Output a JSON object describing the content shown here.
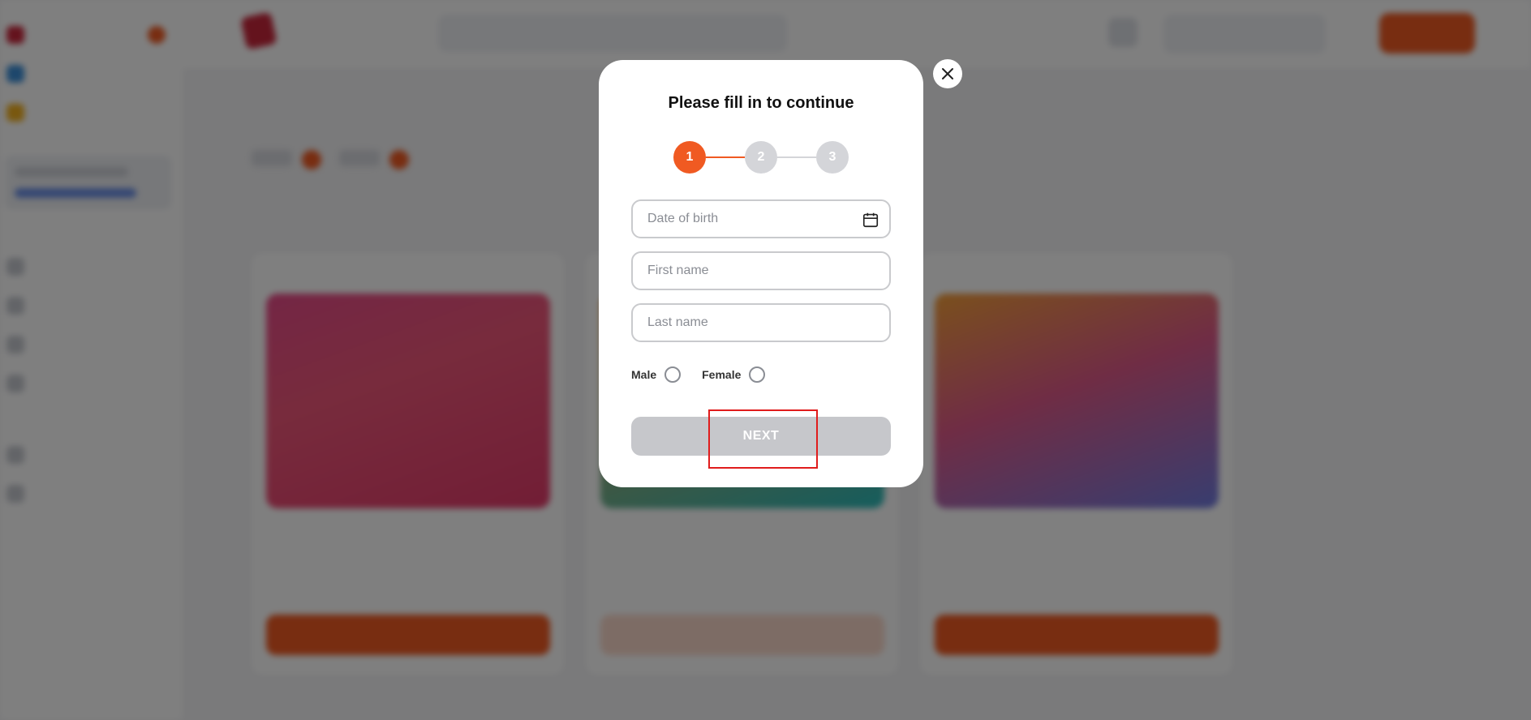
{
  "modal": {
    "title": "Please fill in to continue",
    "steps": [
      "1",
      "2",
      "3"
    ],
    "active_step": 1,
    "fields": {
      "date_of_birth": {
        "placeholder": "Date of birth",
        "value": ""
      },
      "first_name": {
        "placeholder": "First name",
        "value": ""
      },
      "last_name": {
        "placeholder": "Last name",
        "value": ""
      }
    },
    "gender": {
      "male_label": "Male",
      "female_label": "Female"
    },
    "next_label": "NEXT"
  },
  "colors": {
    "accent": "#f05a22",
    "step_inactive": "#d4d5d9",
    "button_disabled": "#c6c7cb",
    "highlight": "#e01c1c"
  },
  "icons": {
    "close": "close-icon",
    "calendar": "calendar-icon"
  }
}
